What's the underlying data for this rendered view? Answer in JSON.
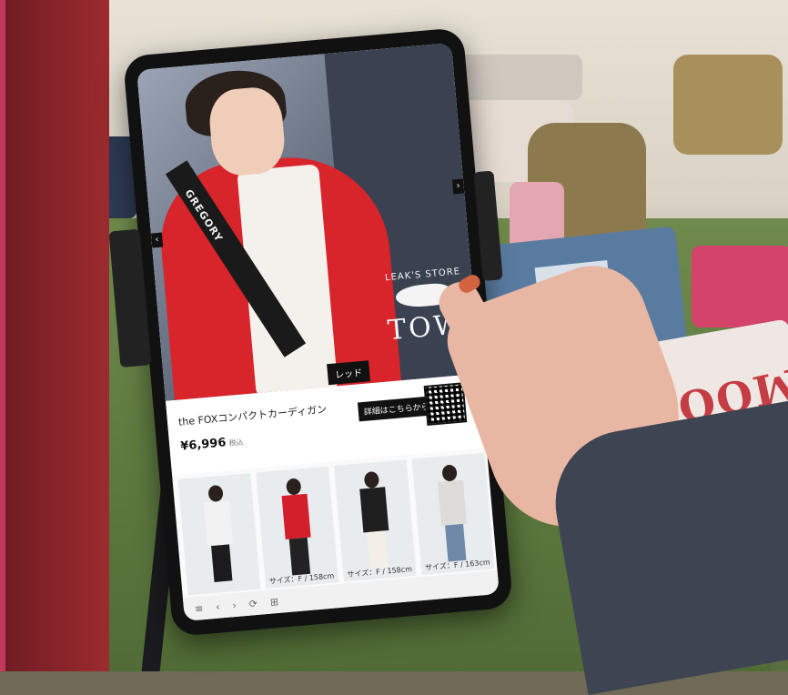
{
  "scene": {
    "sweatshirt_text": "VERMOOD"
  },
  "tablet": {
    "hero": {
      "store_label": "LEAK'S STORE",
      "town_label": "TOWN",
      "color_tag": "レッド",
      "strap_text": "GREGORY",
      "nav_left": "‹",
      "nav_right": "›"
    },
    "product": {
      "name": "the FOXコンパクトカーディガン",
      "price": "¥6,996",
      "tax_note": "税込",
      "detail_button": "詳細はこちらから！"
    },
    "looks": [
      {
        "size": "",
        "top": "#f2f2f2",
        "bottom": "#1c1c1c"
      },
      {
        "size": "サイズ：F / 158cm",
        "top": "#d21f2b",
        "bottom": "#222"
      },
      {
        "size": "サイズ：F / 158cm",
        "top": "#1e1e1e",
        "bottom": "#f3efe6"
      },
      {
        "size": "サイズ：F / 163cm",
        "top": "#dddcd8",
        "bottom": "#6f88a8"
      }
    ],
    "bottom_bar": [
      "≡",
      "‹",
      "›",
      "⟳",
      "⊞"
    ]
  }
}
